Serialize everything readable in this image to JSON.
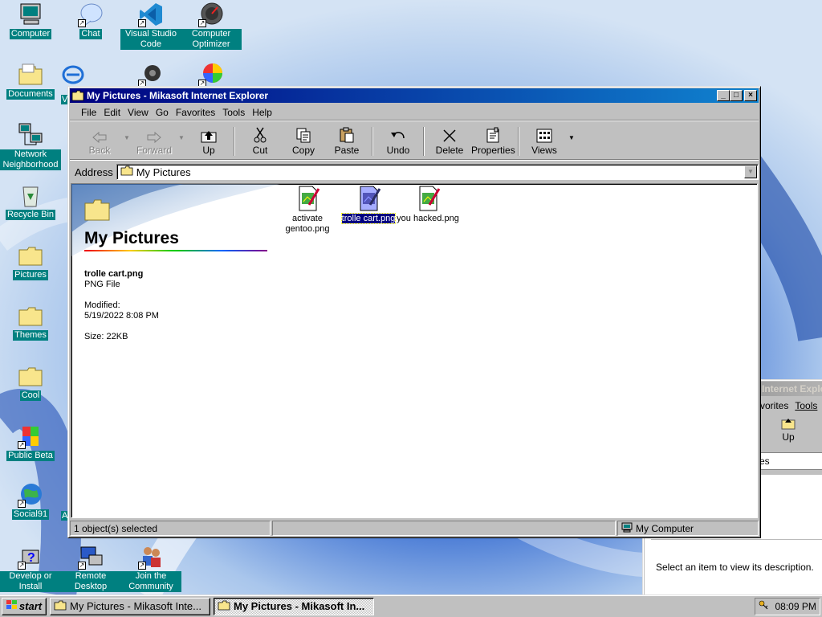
{
  "desktop": {
    "icons": [
      {
        "label": "Computer",
        "icon": "computer-icon"
      },
      {
        "label": "Chat",
        "icon": "chat-icon"
      },
      {
        "label": "Visual Studio Code",
        "icon": "vscode-icon"
      },
      {
        "label": "Computer Optimizer",
        "icon": "optimizer-icon"
      },
      {
        "label": "Documents",
        "icon": "folder-icon"
      },
      {
        "label": "Network Neighborhood",
        "icon": "network-icon"
      },
      {
        "label": "Recycle Bin",
        "icon": "recycle-bin-icon"
      },
      {
        "label": "Pictures",
        "icon": "folder-icon"
      },
      {
        "label": "Themes",
        "icon": "folder-icon"
      },
      {
        "label": "Cool",
        "icon": "folder-icon"
      },
      {
        "label": "Public Beta",
        "icon": "public-beta-icon"
      },
      {
        "label": "Social91",
        "icon": "globe-icon"
      },
      {
        "label": "Develop or Install",
        "icon": "develop-icon"
      },
      {
        "label": "Remote Desktop",
        "icon": "remote-desktop-icon"
      },
      {
        "label": "Join the Community",
        "icon": "community-icon"
      }
    ],
    "partial_labels": [
      "V",
      "A"
    ]
  },
  "window": {
    "title": "My Pictures - Mikasoft Internet Explorer",
    "menu": [
      "File",
      "Edit",
      "View",
      "Go",
      "Favorites",
      "Tools",
      "Help"
    ],
    "toolbar": {
      "back": "Back",
      "forward": "Forward",
      "up": "Up",
      "cut": "Cut",
      "copy": "Copy",
      "paste": "Paste",
      "undo": "Undo",
      "delete": "Delete",
      "properties": "Properties",
      "views": "Views"
    },
    "address_label": "Address",
    "address_value": "My Pictures",
    "pane": {
      "title": "My Pictures",
      "file_name": "trolle cart.png",
      "file_type": "PNG File",
      "modified_label": "Modified:",
      "modified_value": "5/19/2022 8:08 PM",
      "size": "Size: 22KB"
    },
    "files": [
      {
        "name": "activate gentoo.png",
        "selected": false
      },
      {
        "name": "trolle cart.png",
        "selected": true
      },
      {
        "name": "you hacked.png",
        "selected": false
      }
    ],
    "status": {
      "left": "1 object(s) selected",
      "right": "My Computer"
    }
  },
  "background_window": {
    "title": "Internet Explo",
    "menu_partial": "vorites",
    "menu_tools": "Tools",
    "up": "Up",
    "address_partial": "es",
    "description": "Select an item to view its description."
  },
  "taskbar": {
    "start": "start",
    "tasks": [
      {
        "label": "My Pictures - Mikasoft Inte...",
        "active": false
      },
      {
        "label": "My Pictures - Mikasoft In...",
        "active": true
      }
    ],
    "clock": "08:09 PM"
  }
}
